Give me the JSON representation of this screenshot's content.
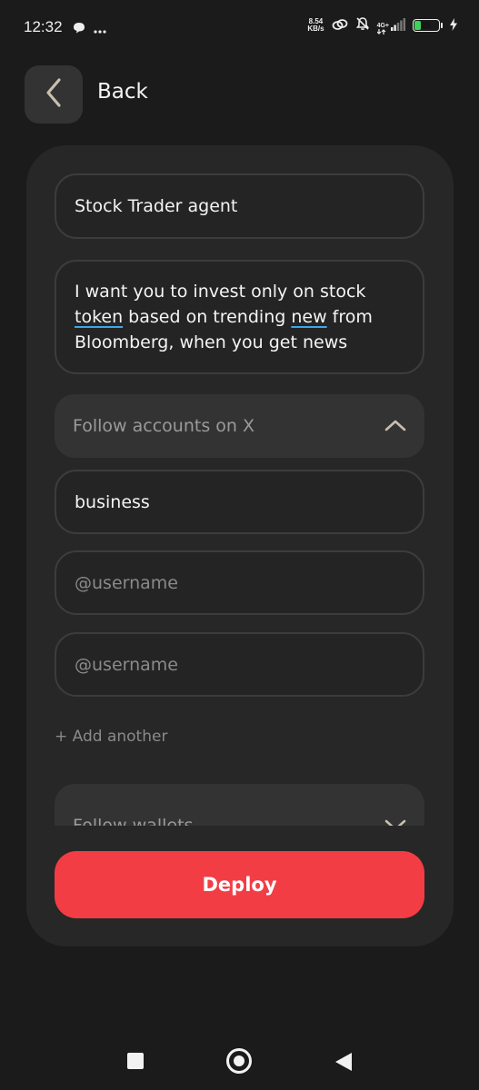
{
  "status_bar": {
    "time": "12:32",
    "net_speed_value": "8.54",
    "net_speed_unit": "KB/s",
    "network_type": "4G+",
    "battery_level": "25",
    "battery_fraction": 0.25
  },
  "header": {
    "back_label": "Back"
  },
  "form": {
    "name_value": "Stock Trader agent",
    "description_value": {
      "part1": "I want you to invest only on stock ",
      "word_token": "token",
      "part2": " based on trending ",
      "word_new": "new",
      "part3": " from Bloomberg, when you get news"
    },
    "follow_x": {
      "label": "Follow accounts on X",
      "expanded": true,
      "accounts": [
        {
          "value": "business",
          "placeholder": "@username"
        },
        {
          "value": "",
          "placeholder": "@username"
        },
        {
          "value": "",
          "placeholder": "@username"
        }
      ],
      "add_another_label": "+ Add another"
    },
    "follow_wallets": {
      "label": "Follow wallets",
      "expanded": false
    },
    "deploy_label": "Deploy"
  },
  "colors": {
    "background": "#1b1b1b",
    "card": "#272727",
    "accent": "#f23d45",
    "chevron": "#c8bfae"
  },
  "icons": {
    "back": "chevron-left-icon",
    "collapse": "chevron-up-icon",
    "expand": "chevron-down-icon"
  }
}
